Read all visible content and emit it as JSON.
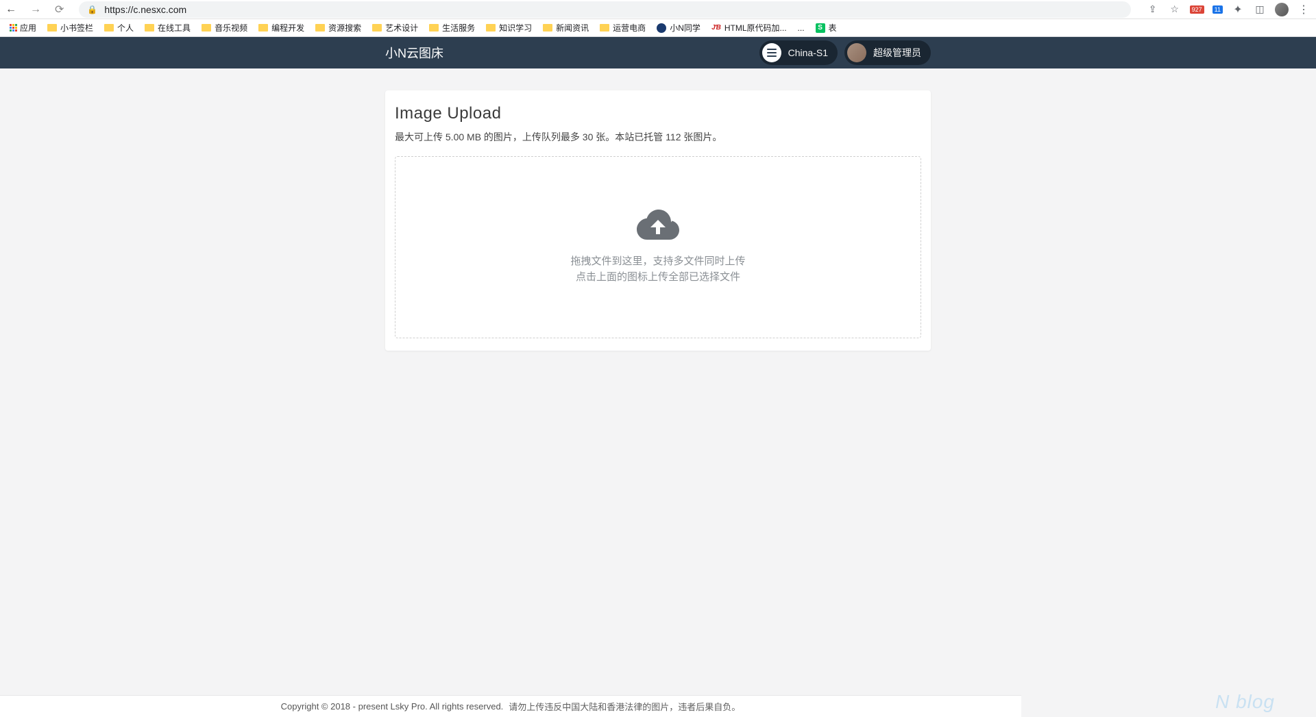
{
  "browser": {
    "url": "https://c.nesxc.com",
    "ext_badge_red": "927",
    "ext_badge_blue": "11"
  },
  "bookmarks": {
    "apps": "应用",
    "items": [
      "小书签栏",
      "个人",
      "在线工具",
      "音乐视频",
      "编程开发",
      "资源搜索",
      "艺术设计",
      "生活服务",
      "知识学习",
      "新闻资讯",
      "运营电商"
    ],
    "xn": "小N同学",
    "html_raw": "HTML原代码加...",
    "overflow": "...",
    "table": "表"
  },
  "header": {
    "logo": "小N云图床",
    "server": "China-S1",
    "user": "超级管理员"
  },
  "upload": {
    "title": "Image Upload",
    "subtitle": "最大可上传 5.00 MB 的图片，上传队列最多 30 张。本站已托管 112 张图片。",
    "drop_line1": "拖拽文件到这里，支持多文件同时上传",
    "drop_line2": "点击上面的图标上传全部已选择文件"
  },
  "footer": {
    "copyright": "Copyright © 2018 - present Lsky Pro. All rights reserved.",
    "notice": "请勿上传违反中国大陆和香港法律的图片，违者后果自负。"
  },
  "watermark": "N blog"
}
